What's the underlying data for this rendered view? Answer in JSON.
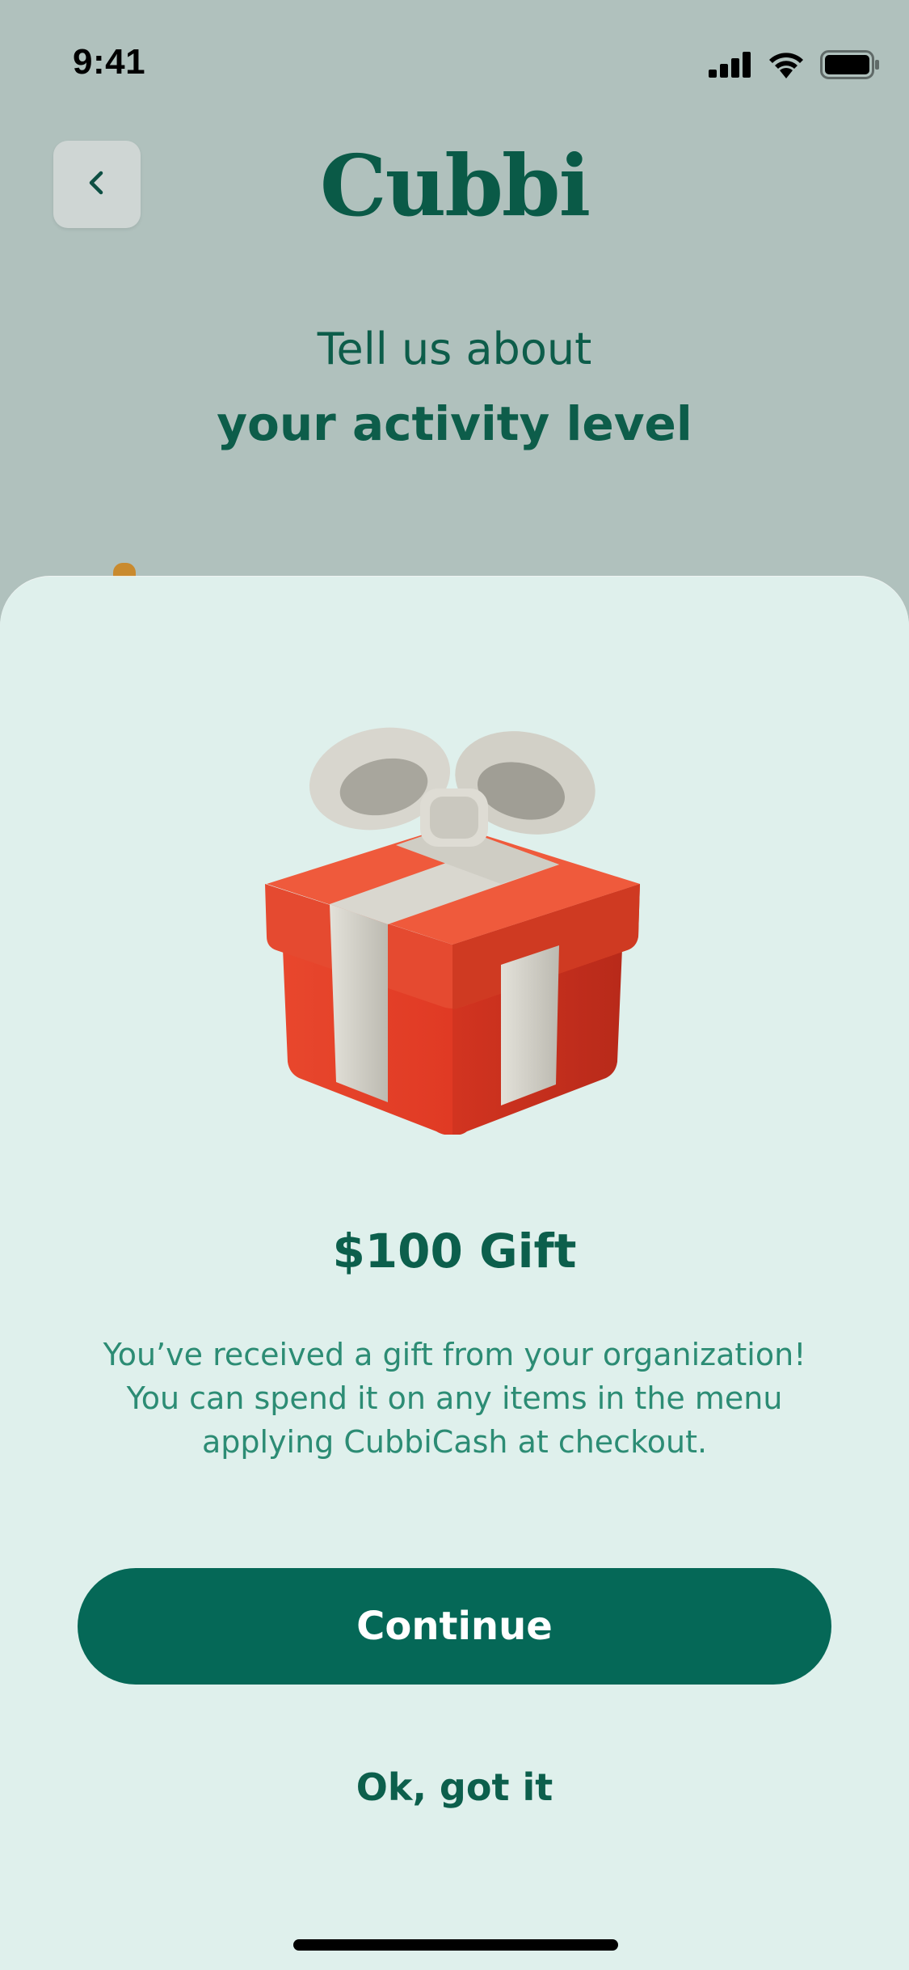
{
  "status_bar": {
    "time": "9:41",
    "icons": [
      "cellular-signal-icon",
      "wifi-icon",
      "battery-icon"
    ]
  },
  "header": {
    "back_icon": "chevron-left-icon",
    "logo_text": "Cubbi"
  },
  "background_screen": {
    "heading_line1": "Tell us about",
    "heading_line2": "your activity level"
  },
  "sheet": {
    "image_icon": "gift-box-icon",
    "title": "$100 Gift",
    "body": "You’ve received a gift from your organization! You can spend it on any items in the menu applying CubbiCash at checkout.",
    "primary_button_label": "Continue",
    "secondary_link_label": "Ok, got it"
  },
  "colors": {
    "brand_green": "#056857",
    "heading_green": "#0c5f4c",
    "body_green": "#2c8c74",
    "sheet_background": "#dff0ec",
    "screen_background": "#b0c1bd",
    "gift_red": "#e2442d",
    "ribbon": "#d5d3cb"
  }
}
